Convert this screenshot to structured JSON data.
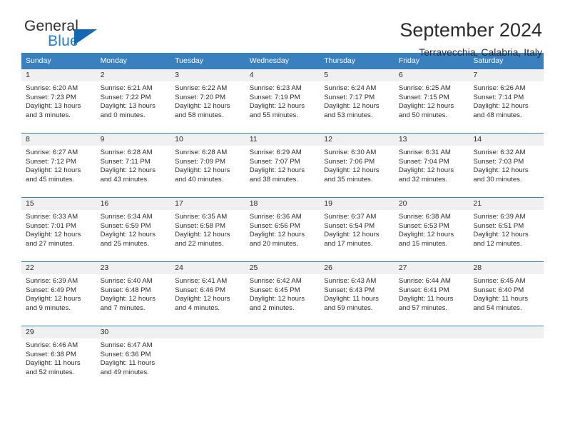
{
  "brand": {
    "name_top": "General",
    "name_bottom": "Blue"
  },
  "header": {
    "title": "September 2024",
    "subtitle": "Terravecchia, Calabria, Italy"
  },
  "colors": {
    "header_blue": "#3a7fbe",
    "brand_blue": "#1d7fd1",
    "triangle_blue": "#1268b3",
    "daynum_band": "#f0f0f0",
    "text": "#2b2b2b"
  },
  "weekday_headers": [
    "Sunday",
    "Monday",
    "Tuesday",
    "Wednesday",
    "Thursday",
    "Friday",
    "Saturday"
  ],
  "weeks": [
    [
      {
        "day": "1",
        "sunrise": "Sunrise: 6:20 AM",
        "sunset": "Sunset: 7:23 PM",
        "daylight1": "Daylight: 13 hours",
        "daylight2": "and 3 minutes."
      },
      {
        "day": "2",
        "sunrise": "Sunrise: 6:21 AM",
        "sunset": "Sunset: 7:22 PM",
        "daylight1": "Daylight: 13 hours",
        "daylight2": "and 0 minutes."
      },
      {
        "day": "3",
        "sunrise": "Sunrise: 6:22 AM",
        "sunset": "Sunset: 7:20 PM",
        "daylight1": "Daylight: 12 hours",
        "daylight2": "and 58 minutes."
      },
      {
        "day": "4",
        "sunrise": "Sunrise: 6:23 AM",
        "sunset": "Sunset: 7:19 PM",
        "daylight1": "Daylight: 12 hours",
        "daylight2": "and 55 minutes."
      },
      {
        "day": "5",
        "sunrise": "Sunrise: 6:24 AM",
        "sunset": "Sunset: 7:17 PM",
        "daylight1": "Daylight: 12 hours",
        "daylight2": "and 53 minutes."
      },
      {
        "day": "6",
        "sunrise": "Sunrise: 6:25 AM",
        "sunset": "Sunset: 7:15 PM",
        "daylight1": "Daylight: 12 hours",
        "daylight2": "and 50 minutes."
      },
      {
        "day": "7",
        "sunrise": "Sunrise: 6:26 AM",
        "sunset": "Sunset: 7:14 PM",
        "daylight1": "Daylight: 12 hours",
        "daylight2": "and 48 minutes."
      }
    ],
    [
      {
        "day": "8",
        "sunrise": "Sunrise: 6:27 AM",
        "sunset": "Sunset: 7:12 PM",
        "daylight1": "Daylight: 12 hours",
        "daylight2": "and 45 minutes."
      },
      {
        "day": "9",
        "sunrise": "Sunrise: 6:28 AM",
        "sunset": "Sunset: 7:11 PM",
        "daylight1": "Daylight: 12 hours",
        "daylight2": "and 43 minutes."
      },
      {
        "day": "10",
        "sunrise": "Sunrise: 6:28 AM",
        "sunset": "Sunset: 7:09 PM",
        "daylight1": "Daylight: 12 hours",
        "daylight2": "and 40 minutes."
      },
      {
        "day": "11",
        "sunrise": "Sunrise: 6:29 AM",
        "sunset": "Sunset: 7:07 PM",
        "daylight1": "Daylight: 12 hours",
        "daylight2": "and 38 minutes."
      },
      {
        "day": "12",
        "sunrise": "Sunrise: 6:30 AM",
        "sunset": "Sunset: 7:06 PM",
        "daylight1": "Daylight: 12 hours",
        "daylight2": "and 35 minutes."
      },
      {
        "day": "13",
        "sunrise": "Sunrise: 6:31 AM",
        "sunset": "Sunset: 7:04 PM",
        "daylight1": "Daylight: 12 hours",
        "daylight2": "and 32 minutes."
      },
      {
        "day": "14",
        "sunrise": "Sunrise: 6:32 AM",
        "sunset": "Sunset: 7:03 PM",
        "daylight1": "Daylight: 12 hours",
        "daylight2": "and 30 minutes."
      }
    ],
    [
      {
        "day": "15",
        "sunrise": "Sunrise: 6:33 AM",
        "sunset": "Sunset: 7:01 PM",
        "daylight1": "Daylight: 12 hours",
        "daylight2": "and 27 minutes."
      },
      {
        "day": "16",
        "sunrise": "Sunrise: 6:34 AM",
        "sunset": "Sunset: 6:59 PM",
        "daylight1": "Daylight: 12 hours",
        "daylight2": "and 25 minutes."
      },
      {
        "day": "17",
        "sunrise": "Sunrise: 6:35 AM",
        "sunset": "Sunset: 6:58 PM",
        "daylight1": "Daylight: 12 hours",
        "daylight2": "and 22 minutes."
      },
      {
        "day": "18",
        "sunrise": "Sunrise: 6:36 AM",
        "sunset": "Sunset: 6:56 PM",
        "daylight1": "Daylight: 12 hours",
        "daylight2": "and 20 minutes."
      },
      {
        "day": "19",
        "sunrise": "Sunrise: 6:37 AM",
        "sunset": "Sunset: 6:54 PM",
        "daylight1": "Daylight: 12 hours",
        "daylight2": "and 17 minutes."
      },
      {
        "day": "20",
        "sunrise": "Sunrise: 6:38 AM",
        "sunset": "Sunset: 6:53 PM",
        "daylight1": "Daylight: 12 hours",
        "daylight2": "and 15 minutes."
      },
      {
        "day": "21",
        "sunrise": "Sunrise: 6:39 AM",
        "sunset": "Sunset: 6:51 PM",
        "daylight1": "Daylight: 12 hours",
        "daylight2": "and 12 minutes."
      }
    ],
    [
      {
        "day": "22",
        "sunrise": "Sunrise: 6:39 AM",
        "sunset": "Sunset: 6:49 PM",
        "daylight1": "Daylight: 12 hours",
        "daylight2": "and 9 minutes."
      },
      {
        "day": "23",
        "sunrise": "Sunrise: 6:40 AM",
        "sunset": "Sunset: 6:48 PM",
        "daylight1": "Daylight: 12 hours",
        "daylight2": "and 7 minutes."
      },
      {
        "day": "24",
        "sunrise": "Sunrise: 6:41 AM",
        "sunset": "Sunset: 6:46 PM",
        "daylight1": "Daylight: 12 hours",
        "daylight2": "and 4 minutes."
      },
      {
        "day": "25",
        "sunrise": "Sunrise: 6:42 AM",
        "sunset": "Sunset: 6:45 PM",
        "daylight1": "Daylight: 12 hours",
        "daylight2": "and 2 minutes."
      },
      {
        "day": "26",
        "sunrise": "Sunrise: 6:43 AM",
        "sunset": "Sunset: 6:43 PM",
        "daylight1": "Daylight: 11 hours",
        "daylight2": "and 59 minutes."
      },
      {
        "day": "27",
        "sunrise": "Sunrise: 6:44 AM",
        "sunset": "Sunset: 6:41 PM",
        "daylight1": "Daylight: 11 hours",
        "daylight2": "and 57 minutes."
      },
      {
        "day": "28",
        "sunrise": "Sunrise: 6:45 AM",
        "sunset": "Sunset: 6:40 PM",
        "daylight1": "Daylight: 11 hours",
        "daylight2": "and 54 minutes."
      }
    ],
    [
      {
        "day": "29",
        "sunrise": "Sunrise: 6:46 AM",
        "sunset": "Sunset: 6:38 PM",
        "daylight1": "Daylight: 11 hours",
        "daylight2": "and 52 minutes."
      },
      {
        "day": "30",
        "sunrise": "Sunrise: 6:47 AM",
        "sunset": "Sunset: 6:36 PM",
        "daylight1": "Daylight: 11 hours",
        "daylight2": "and 49 minutes."
      },
      {
        "day": "",
        "sunrise": "",
        "sunset": "",
        "daylight1": "",
        "daylight2": ""
      },
      {
        "day": "",
        "sunrise": "",
        "sunset": "",
        "daylight1": "",
        "daylight2": ""
      },
      {
        "day": "",
        "sunrise": "",
        "sunset": "",
        "daylight1": "",
        "daylight2": ""
      },
      {
        "day": "",
        "sunrise": "",
        "sunset": "",
        "daylight1": "",
        "daylight2": ""
      },
      {
        "day": "",
        "sunrise": "",
        "sunset": "",
        "daylight1": "",
        "daylight2": ""
      }
    ]
  ]
}
